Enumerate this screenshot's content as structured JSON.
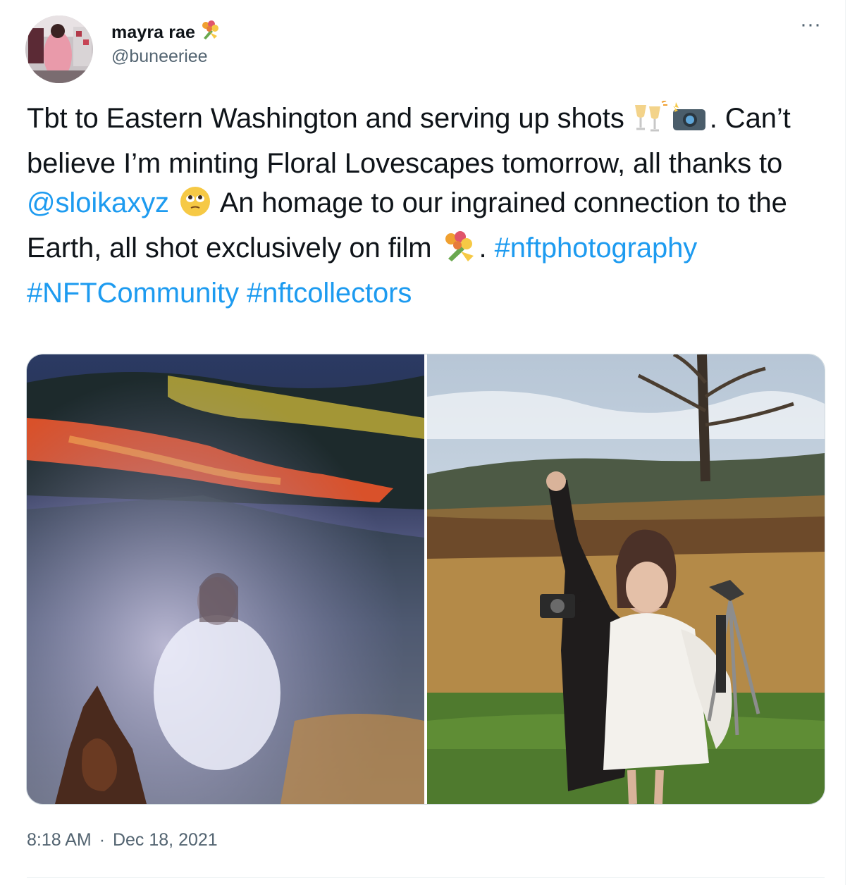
{
  "tweet": {
    "author": {
      "display_name": "mayra rae",
      "name_emoji": "bouquet-icon",
      "handle": "@buneeriee"
    },
    "text": {
      "part1": "Tbt to Eastern Washington and serving up shots ",
      "part2": ". Can’t believe I’m minting Floral Lovescapes tomorrow, all thanks to ",
      "mention": "@sloikaxyz",
      "part3": " An homage to our ingrained connection to the Earth, all shot exclusively on film ",
      "part4": ". ",
      "hashtag1": "#nftphotography",
      "hashtag2": "#NFTCommunity",
      "hashtag3": "#nftcollectors"
    },
    "time": "8:18 AM",
    "separator": "·",
    "date": "Dec 18, 2021",
    "more_label": "···"
  },
  "colors": {
    "link": "#1d9bf0",
    "secondary_text": "#536471",
    "border": "#cfd9de"
  }
}
